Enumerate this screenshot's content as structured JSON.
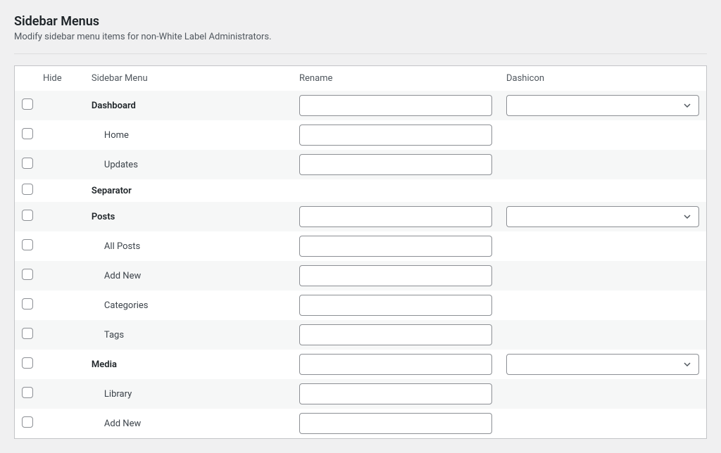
{
  "section": {
    "title": "Sidebar Menus",
    "description": "Modify sidebar menu items for non-White Label Administrators."
  },
  "columns": {
    "hide": "Hide",
    "menu": "Sidebar Menu",
    "rename": "Rename",
    "dashicon": "Dashicon"
  },
  "rows": [
    {
      "type": "parent",
      "label": "Dashboard",
      "rename": "",
      "dashicon": "",
      "zebra": true
    },
    {
      "type": "child",
      "label": "Home",
      "rename": "",
      "zebra": false
    },
    {
      "type": "child",
      "label": "Updates",
      "rename": "",
      "zebra": true
    },
    {
      "type": "separator",
      "label": "Separator",
      "zebra": false
    },
    {
      "type": "parent",
      "label": "Posts",
      "rename": "",
      "dashicon": "",
      "zebra": true
    },
    {
      "type": "child",
      "label": "All Posts",
      "rename": "",
      "zebra": false
    },
    {
      "type": "child",
      "label": "Add New",
      "rename": "",
      "zebra": true
    },
    {
      "type": "child",
      "label": "Categories",
      "rename": "",
      "zebra": false
    },
    {
      "type": "child",
      "label": "Tags",
      "rename": "",
      "zebra": true
    },
    {
      "type": "parent",
      "label": "Media",
      "rename": "",
      "dashicon": "",
      "zebra": false
    },
    {
      "type": "child",
      "label": "Library",
      "rename": "",
      "zebra": true
    },
    {
      "type": "child",
      "label": "Add New",
      "rename": "",
      "zebra": false
    }
  ]
}
